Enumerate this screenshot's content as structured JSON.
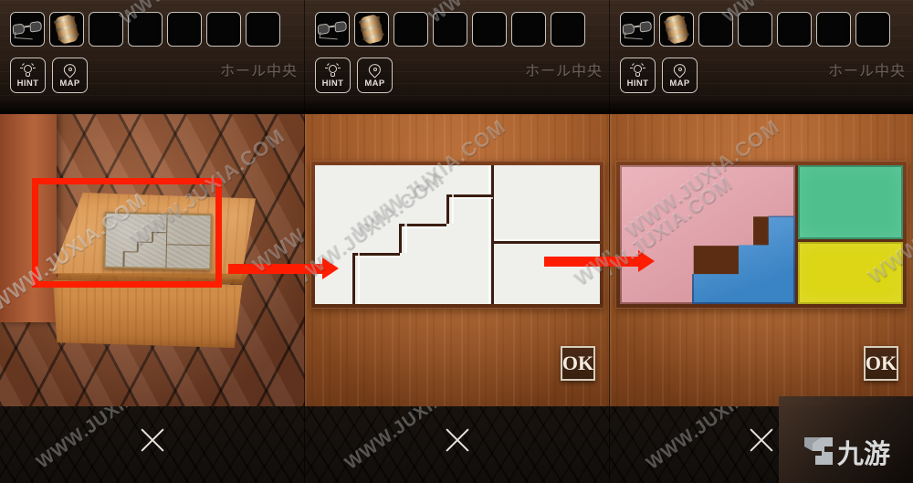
{
  "hud": {
    "slots": [
      {
        "name": "glasses",
        "filled": true
      },
      {
        "name": "barrel",
        "filled": true
      },
      {
        "name": "empty-3",
        "filled": false
      },
      {
        "name": "empty-4",
        "filled": false
      },
      {
        "name": "empty-5",
        "filled": false
      },
      {
        "name": "empty-6",
        "filled": false
      },
      {
        "name": "empty-7",
        "filled": false
      }
    ],
    "hint_label": "HINT",
    "map_label": "MAP",
    "location_label": "ホール中央"
  },
  "panels": [
    {
      "id": "panel-1",
      "caption": "wooden box with stone puzzle plate on cobblestone floor",
      "has_ok": false,
      "highlight": "red-rectangle-around-puzzle-plate"
    },
    {
      "id": "panel-2",
      "caption": "close-up of white sliding block puzzle in wooden frame",
      "has_ok": true,
      "ok_label": "OK"
    },
    {
      "id": "panel-3",
      "caption": "solved puzzle with coloured blocks",
      "has_ok": true,
      "ok_label": "OK"
    }
  ],
  "footer": {
    "close_label": "×"
  },
  "watermark": {
    "text": "WWW.JUXIA.COM"
  },
  "logo": {
    "text": "九游"
  },
  "colors": {
    "accent_red": "#ff1d00",
    "piece_pink": "#e8a5ae",
    "piece_blue": "#3f8ed4",
    "piece_green": "#4fc08d",
    "piece_yellow": "#dcd617",
    "wood_frame": "#6b3418",
    "board_white": "#efefec",
    "seam_dark": "#3a1d10"
  },
  "puzzle": {
    "type": "sliding-block",
    "board_cols": 12,
    "board_rows": 6,
    "pieces": [
      {
        "name": "pink-large-staircase",
        "color": "#e8a5ae",
        "shape": "staircase-left",
        "cells": 36
      },
      {
        "name": "blue-staircase",
        "color": "#3f8ed4",
        "shape": "staircase-right",
        "cells": 18
      },
      {
        "name": "green-rectangle",
        "color": "#4fc08d",
        "shape": "rect",
        "cells": 18
      },
      {
        "name": "yellow-rectangle",
        "color": "#dcd617",
        "shape": "rect",
        "cells": 18
      }
    ]
  }
}
